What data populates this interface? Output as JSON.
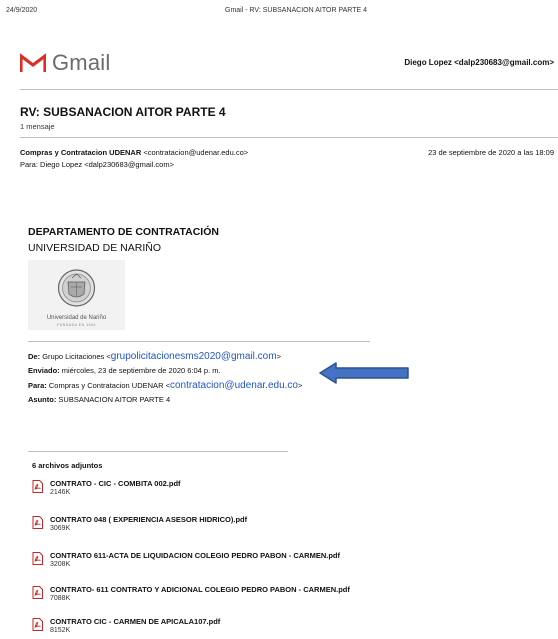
{
  "print_header": {
    "date": "24/9/2020",
    "title": "Gmail - RV: SUBSANACION AITOR PARTE 4"
  },
  "app": {
    "name": "Gmail",
    "account": "Diego Lopez <dalp230683@gmail.com>"
  },
  "thread": {
    "subject": "RV: SUBSANACION AITOR PARTE 4",
    "message_count": "1 mensaje"
  },
  "message": {
    "from_name": "Compras y Contratacion UDENAR",
    "from_email": "<contratacion@udenar.edu.co>",
    "date": "23 de septiembre de 2020 a las 18:09",
    "to_label": "Para:",
    "to_value": "Diego Lopez <dalp230683@gmail.com>"
  },
  "body": {
    "department": "DEPARTAMENTO DE CONTRATACIÓN",
    "university": "UNIVERSIDAD DE NARIÑO",
    "seal_label": "Universidad de Nariño",
    "seal_sub": "FUNDADA EN 1904"
  },
  "forwarded": {
    "from_label": "De:",
    "from_name": "Grupo Licitaciones <",
    "from_email": "grupolicitacionesms2020@gmail.com",
    "from_close": ">",
    "sent_label": "Enviado:",
    "sent_value": "miércoles, 23 de septiembre de 2020 6:04 p. m.",
    "to_label": "Para:",
    "to_name": "Compras y Contratacion UDENAR <",
    "to_email": "contratacion@udenar.edu.co",
    "to_close": ">",
    "subject_label": "Asunto:",
    "subject_value": "SUBSANACION AITOR PARTE 4"
  },
  "attachments": {
    "count_label": "6 archivos adjuntos",
    "items": [
      {
        "name": "CONTRATO - CIC - COMBITA 002.pdf",
        "size": "2146K"
      },
      {
        "name": "CONTRATO 048 ( EXPERIENCIA ASESOR HIDRICO).pdf",
        "size": "3069K"
      },
      {
        "name": "CONTRATO 611-ACTA DE LIQUIDACION COLEGIO PEDRO PABON - CARMEN.pdf",
        "size": "3208K"
      },
      {
        "name": "CONTRATO- 611 CONTRATO Y ADICIONAL COLEGIO PEDRO PABON - CARMEN.pdf",
        "size": "7088K"
      },
      {
        "name": "CONTRATO CIC - CARMEN DE APICALA107.pdf",
        "size": "8152K"
      }
    ]
  },
  "colors": {
    "gmail_red": "#d93025",
    "link": "#2156c9",
    "arrow_fill": "#4472c4",
    "arrow_stroke": "#2f528f"
  }
}
